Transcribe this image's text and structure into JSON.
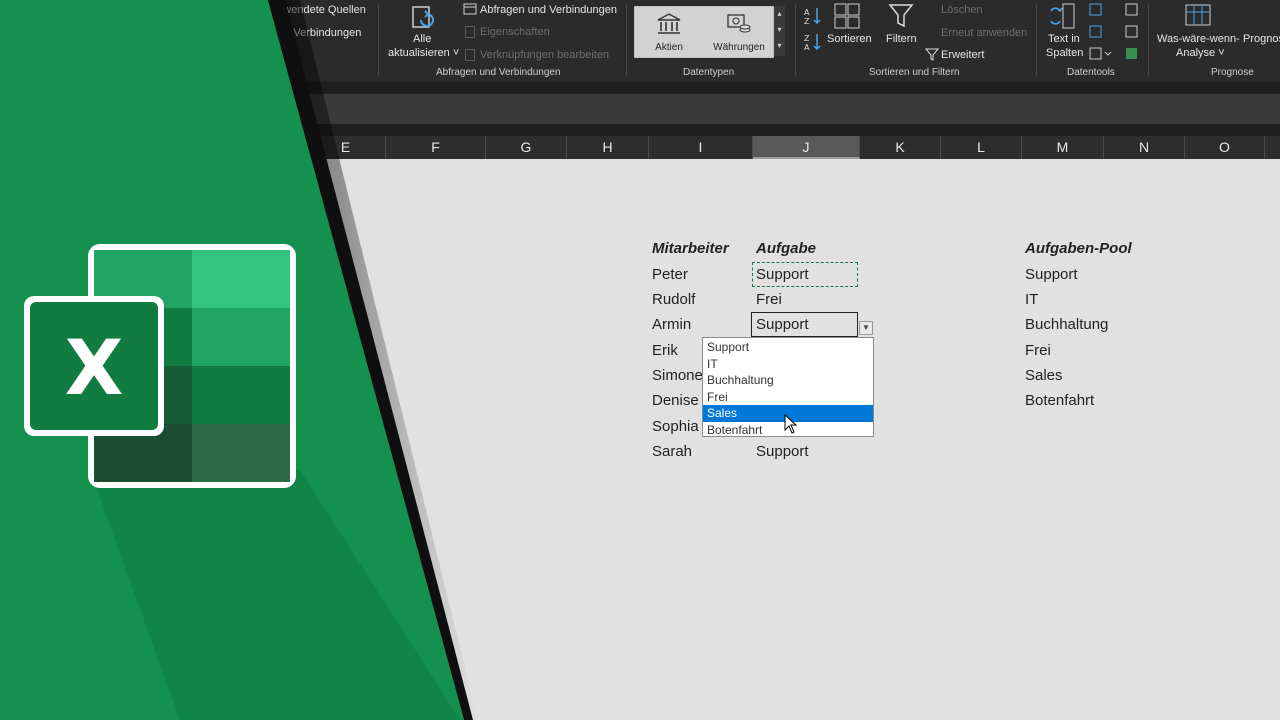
{
  "ribbon": {
    "items": {
      "used_sources": "verwendete Quellen",
      "existing_connections": "ene Verbindungen",
      "refresh_all_line1": "Alle",
      "refresh_all_line2": "aktualisieren ˅",
      "queries_connections": "Abfragen und Verbindungen",
      "properties": "Eigenschaften",
      "edit_links": "Verknüpfungen bearbeiten",
      "stocks": "Aktien",
      "currencies": "Währungen",
      "sort": "Sortieren",
      "filter": "Filtern",
      "clear": "Löschen",
      "reapply": "Erneut anwenden",
      "advanced": "Erweitert",
      "text_to_columns_line1": "Text in",
      "text_to_columns_line2": "Spalten",
      "what_if_line1": "Was-wäre-wenn-",
      "what_if_line2": "Analyse ˅",
      "forecast": "Prognos"
    },
    "groups": {
      "queries": "Abfragen und Verbindungen",
      "datatypes": "Datentypen",
      "sort_filter": "Sortieren und Filtern",
      "datatools": "Datentools",
      "forecast": "Prognose"
    }
  },
  "columns": [
    "E",
    "F",
    "G",
    "H",
    "I",
    "J",
    "K",
    "L",
    "M",
    "N",
    "O"
  ],
  "selected_column": "J",
  "table": {
    "header_employee": "Mitarbeiter",
    "header_task": "Aufgabe",
    "employees": [
      "Peter",
      "Rudolf",
      "Armin",
      "Erik",
      "Simone",
      "Denise",
      "Sophia",
      "Sarah"
    ],
    "tasks": [
      "Support",
      "Frei",
      "Support",
      "",
      "",
      "",
      "",
      "Support"
    ]
  },
  "pool": {
    "header": "Aufgaben-Pool",
    "items": [
      "Support",
      "IT",
      "Buchhaltung",
      "Frei",
      "Sales",
      "Botenfahrt"
    ]
  },
  "dropdown": {
    "options": [
      "Support",
      "IT",
      "Buchhaltung",
      "Frei",
      "Sales",
      "Botenfahrt"
    ],
    "highlighted": "Sales"
  },
  "logo_letter": "X",
  "colors": {
    "brand_green": "#14904f",
    "highlight": "#0078d7",
    "marquee": "#217346"
  }
}
